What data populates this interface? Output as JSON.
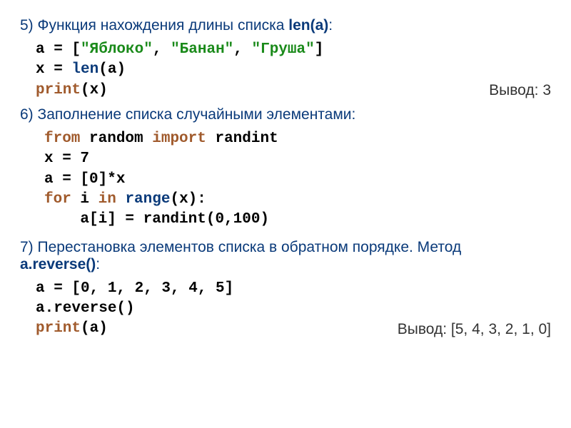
{
  "sec5": {
    "heading_pre": "5) Функция нахождения длины списка ",
    "heading_fn": "len(a)",
    "heading_post": ":",
    "code_l1_a": "a = [",
    "code_l1_b": "\"Яблоко\"",
    "code_l1_c": ", ",
    "code_l1_d": "\"Банан\"",
    "code_l1_e": ", ",
    "code_l1_f": "\"Груша\"",
    "code_l1_g": "]",
    "code_l2_a": "x = ",
    "code_l2_b": "len",
    "code_l2_c": "(a)",
    "code_l3_a": "print",
    "code_l3_b": "(x)",
    "output": "Вывод: 3"
  },
  "sec6": {
    "heading": "6) Заполнение списка случайными элементами:",
    "code_l1_a": "from",
    "code_l1_b": " random ",
    "code_l1_c": "import",
    "code_l1_d": " randint",
    "code_l2": "x = 7",
    "code_l3": "a = [0]*x",
    "code_l4_a": "for",
    "code_l4_b": " i ",
    "code_l4_c": "in",
    "code_l4_d": " ",
    "code_l4_e": "range",
    "code_l4_f": "(x):",
    "code_l5": "    a[i] = randint(0,100)"
  },
  "sec7": {
    "heading_pre": "7) Перестановка элементов списка в обратном порядке. Метод ",
    "heading_fn": "a.reverse()",
    "heading_post": ":",
    "code_l1": "a = [0, 1, 2, 3, 4, 5]",
    "code_l2": "a.reverse()",
    "code_l3_a": "print",
    "code_l3_b": "(a)",
    "output": "Вывод: [5, 4, 3, 2, 1, 0]"
  }
}
